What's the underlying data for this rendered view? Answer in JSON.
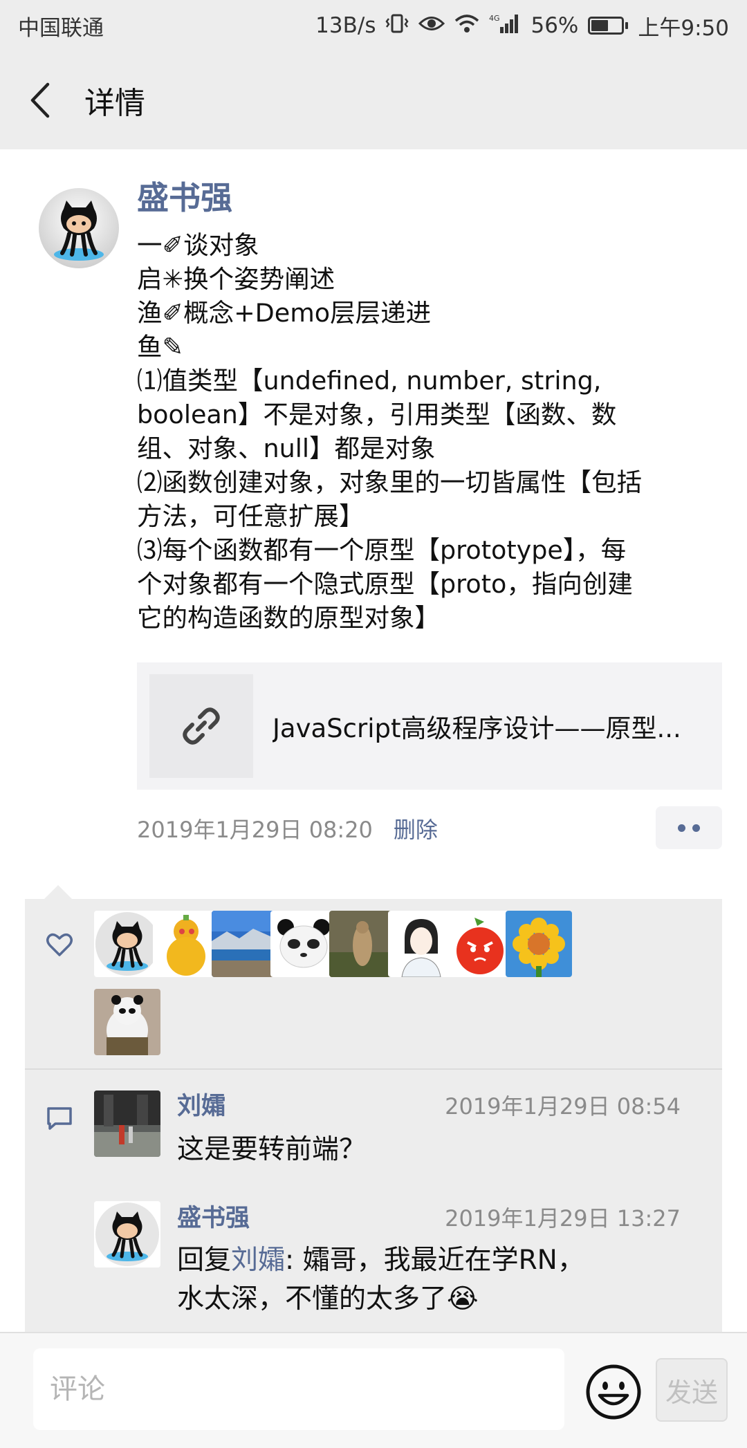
{
  "status_bar": {
    "carrier": "中国联通",
    "net_speed": "13B/s",
    "signal_tag": "4G",
    "battery": "56%",
    "battery_level": 0.56,
    "time": "上午9:50"
  },
  "header": {
    "title": "详情",
    "back_icon": "chevron-left-icon"
  },
  "post": {
    "author": "盛书强",
    "lines": [
      "一✐谈对象",
      "启✳换个姿势阐述",
      "渔✐概念+Demo层层递进",
      "鱼✎",
      "⑴值类型【undefined, number, string,",
      "boolean】不是对象，引用类型【函数、数",
      "组、对象、null】都是对象",
      "⑵函数创建对象，对象里的一切皆属性【包括",
      "方法，可任意扩展】",
      "⑶每个函数都有一个原型【prototype】，每",
      "个对象都有一个隐式原型【proto，指向创建",
      "它的构造函数的原型对象】"
    ],
    "link": {
      "icon": "link-icon",
      "title": "JavaScript高级程序设计——原型..."
    },
    "time": "2019年1月29日 08:20",
    "delete_label": "删除"
  },
  "likes": {
    "icon": "heart-outline-icon",
    "users": [
      {
        "avatar": "octocat-avatar"
      },
      {
        "avatar": "gourd-avatar"
      },
      {
        "avatar": "lake-landscape-avatar"
      },
      {
        "avatar": "panda-cartoon-avatar"
      },
      {
        "avatar": "marmot-avatar"
      },
      {
        "avatar": "girl-sketch-avatar"
      },
      {
        "avatar": "angry-fruit-avatar"
      },
      {
        "avatar": "sunflower-avatar"
      },
      {
        "avatar": "kungfu-panda-avatar"
      }
    ]
  },
  "comments": [
    {
      "avatar": "street-photo-avatar",
      "name": "刘孀",
      "time": "2019年1月29日 08:54",
      "text": "这是要转前端？"
    },
    {
      "avatar": "octocat-avatar",
      "name": "盛书强",
      "time": "2019年1月29日 13:27",
      "reply_prefix": "回复",
      "reply_to": "刘孀",
      "text_first": ": 孀哥，我最近在学RN，",
      "text_second": "水太深，不懂的太多了😭"
    }
  ],
  "comment_bar": {
    "placeholder": "评论",
    "emoji_icon": "smiley-icon",
    "send_label": "发送"
  },
  "colors": {
    "link_blue": "#576b95",
    "header_bg": "#ededed",
    "panel_bg": "#ededed"
  }
}
